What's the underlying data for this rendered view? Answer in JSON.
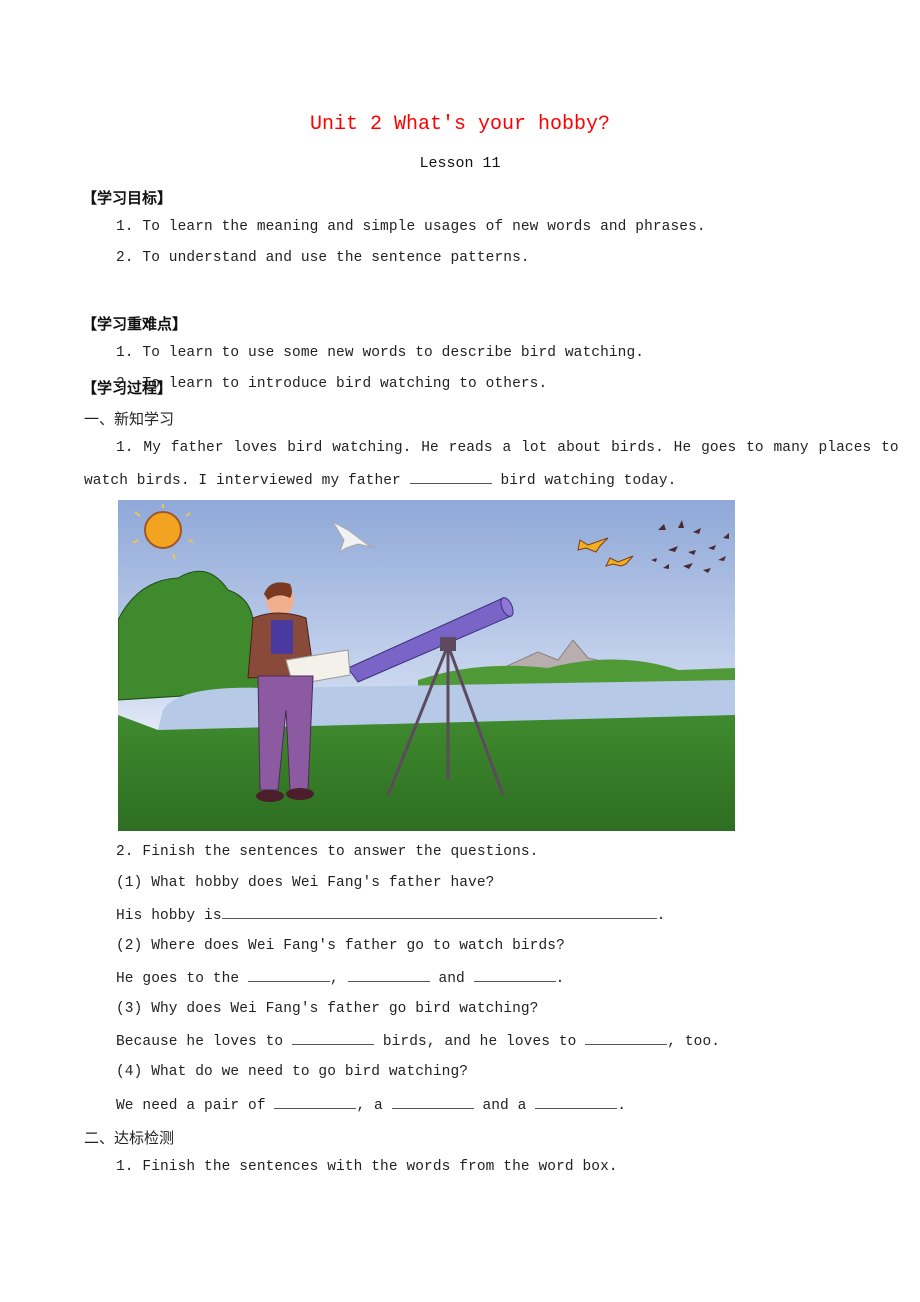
{
  "title": "Unit 2 What's your hobby?",
  "subtitle": "Lesson 11",
  "sections": {
    "objectives": {
      "heading": "【学习目标】",
      "items": [
        "1. To learn the meaning and simple usages of new words and phrases.",
        "2. To understand and use the sentence patterns."
      ]
    },
    "key_points": {
      "heading": "【学习重难点】",
      "items": [
        "1. To learn to use some new words to describe bird watching.",
        "2. To learn to introduce bird watching to others."
      ]
    },
    "process": {
      "heading": "【学习过程】",
      "part1": {
        "heading": "一、新知学习",
        "q1_line1": "1. My father loves bird watching. He reads a lot about birds. He goes to many places to",
        "q1_line2_a": "watch birds. I interviewed my father ",
        "q1_line2_b": " bird watching today.",
        "image_alt": "Man with a book standing beside a telescope on a tripod, watching birds by a lake",
        "q2_heading": "2. Finish the sentences to answer the questions.",
        "questions": [
          {
            "q": "(1) What hobby does Wei Fang's father have?",
            "a_parts": [
              "His hobby is",
              "."
            ]
          },
          {
            "q": "(2) Where does Wei Fang's father go to watch birds?",
            "a_parts": [
              "He goes to the ",
              ", ",
              " and ",
              "."
            ]
          },
          {
            "q": "(3) Why does Wei Fang's father go bird watching?",
            "a_parts": [
              "Because he loves to ",
              " birds, and he loves to ",
              ", too."
            ]
          },
          {
            "q": "(4) What do we need to go bird watching?",
            "a_parts": [
              "We need a pair of ",
              ", a ",
              " and a ",
              "."
            ]
          }
        ]
      },
      "part2": {
        "heading": "二、达标检测",
        "item1": "1. Finish the sentences with the words from the word box."
      }
    }
  },
  "colors": {
    "title": "#ff0000",
    "text": "#222222"
  }
}
